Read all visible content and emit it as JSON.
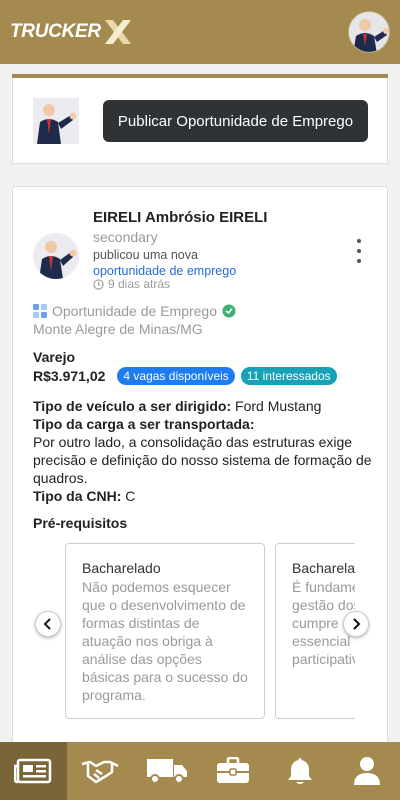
{
  "app": {
    "logo_text": "TRUCKER",
    "logo_mark": "X"
  },
  "publish": {
    "button_label": "Publicar Oportunidade de Emprego"
  },
  "post": {
    "author": "EIRELI Ambrósio EIRELI",
    "role": "secondary",
    "action_text": "publicou uma nova",
    "action_link": "oportunidade de emprego",
    "time": "9 dias atrás",
    "type_label": "Oportunidade de Emprego",
    "location": "Monte Alegre de Minas/MG",
    "category": "Varejo",
    "price": "R$3.971,02",
    "badge_vacancies": "4 vagas disponíveis",
    "badge_interested": "11 interessados",
    "vehicle_label": "Tipo de veículo a ser dirigido:",
    "vehicle_value": "Ford Mustang",
    "cargo_label": "Tipo da carga a ser transportada:",
    "cargo_value": "Por outro lado, a consolidação das estruturas exige precisão e definição do nosso sistema de formação de quadros.",
    "cnh_label": "Tipo da CNH:",
    "cnh_value": "C",
    "prereq_title": "Pré-requisitos",
    "requirements": [
      {
        "title": "Bacharelado",
        "text": "Não podemos esquecer que o desenvolvimento de formas distintas de atuação nos obriga à análise das opções básicas para o sucesso do programa."
      },
      {
        "title": "Bacharelado",
        "text": "É fundamental que a gestão dos esforços cumpre um papel essencial dos cargos participativos."
      }
    ]
  },
  "colors": {
    "brand_gold": "#a58a4f",
    "nav_active": "#7a6538",
    "badge_blue": "#1d7cf2",
    "badge_teal": "#17a2b8",
    "link_blue": "#2a6ad8"
  },
  "nav": {
    "items": [
      {
        "icon": "newspaper-icon",
        "active": true
      },
      {
        "icon": "handshake-icon",
        "active": false
      },
      {
        "icon": "truck-icon",
        "active": false
      },
      {
        "icon": "briefcase-icon",
        "active": false
      },
      {
        "icon": "bell-icon",
        "active": false
      },
      {
        "icon": "user-icon",
        "active": false
      }
    ]
  }
}
